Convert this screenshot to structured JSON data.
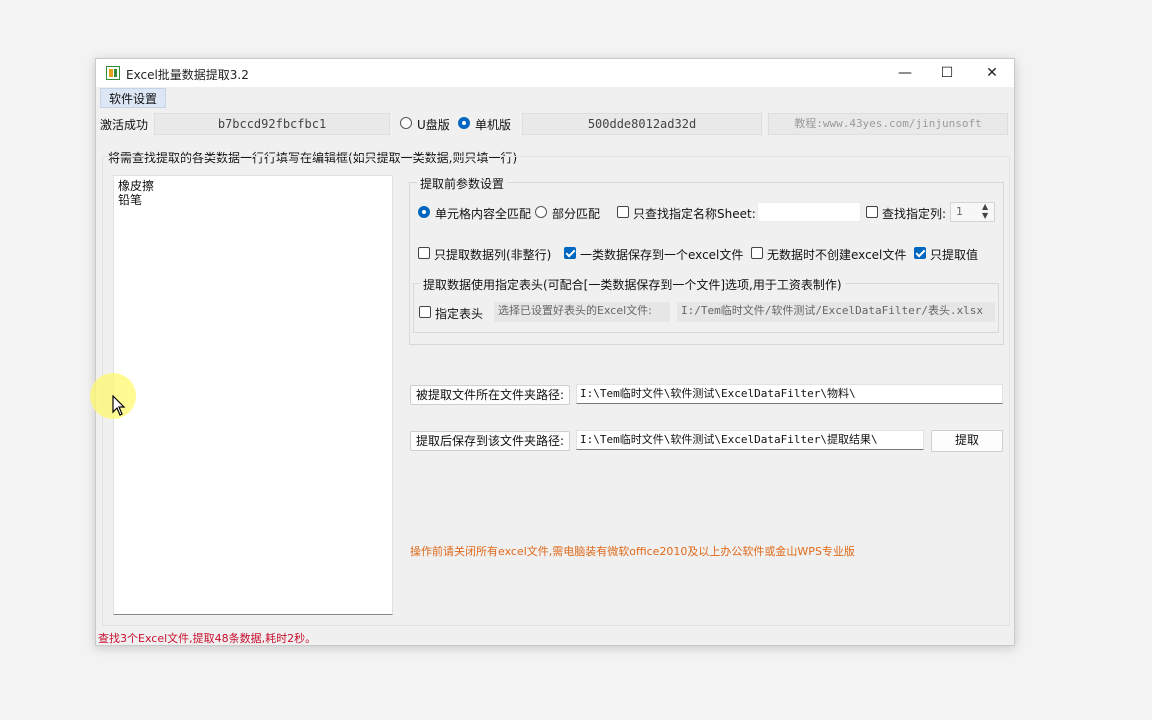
{
  "window": {
    "title": "Excel批量数据提取3.2",
    "minimize_glyph": "—",
    "maximize_glyph": "☐",
    "close_glyph": "✕"
  },
  "menu": {
    "settings": "软件设置"
  },
  "activation": {
    "label": "激活成功",
    "code1": "b7bccd92fbcfbc1",
    "usb_label": "U盘版",
    "single_label": "单机版",
    "selected": "单机版",
    "code2": "500dde8012ad32d",
    "tutorial": "教程:www.43yes.com/jinjunsoft"
  },
  "instruction": "将需查找提取的各类数据一行行填写在编辑框(如只提取一类数据,则只填一行)",
  "editor_lines": [
    "橡皮擦",
    "铅笔"
  ],
  "params": {
    "group_title": "提取前参数设置",
    "exact_match": "单元格内容全匹配",
    "partial_match": "部分匹配",
    "match_selected": "单元格内容全匹配",
    "only_sheet_label": "只查找指定名称Sheet:",
    "only_sheet_checked": false,
    "sheet_name_value": "",
    "only_column_label": "查找指定列:",
    "only_column_checked": false,
    "column_value": "1",
    "only_data_col_label": "只提取数据列(非整行)",
    "only_data_col_checked": false,
    "one_type_one_file_label": "一类数据保存到一个excel文件",
    "one_type_one_file_checked": true,
    "no_data_no_file_label": "无数据时不创建excel文件",
    "no_data_no_file_checked": false,
    "only_values_label": "只提取值",
    "only_values_checked": true
  },
  "header_group": {
    "title": "提取数据使用指定表头(可配合[一类数据保存到一个文件]选项,用于工资表制作)",
    "specify_header_label": "指定表头",
    "specify_header_checked": false,
    "choose_label": "选择已设置好表头的Excel文件:",
    "header_path": "I:/Tem临时文件/软件测试/ExcelDataFilter/表头.xlsx"
  },
  "paths": {
    "source_button": "被提取文件所在文件夹路径:",
    "source_value": "I:\\Tem临时文件\\软件测试\\ExcelDataFilter\\物料\\",
    "save_button": "提取后保存到该文件夹路径:",
    "save_value": "I:\\Tem临时文件\\软件测试\\ExcelDataFilter\\提取结果\\",
    "extract_button": "提取"
  },
  "notice": "操作前请关闭所有excel文件,需电脑装有微软office2010及以上办公软件或金山WPS专业版",
  "status": "查找3个Excel文件,提取48条数据,耗时2秒。",
  "colors": {
    "accent": "#0067c0",
    "notice": "#e0691a",
    "status": "#c8102e"
  }
}
